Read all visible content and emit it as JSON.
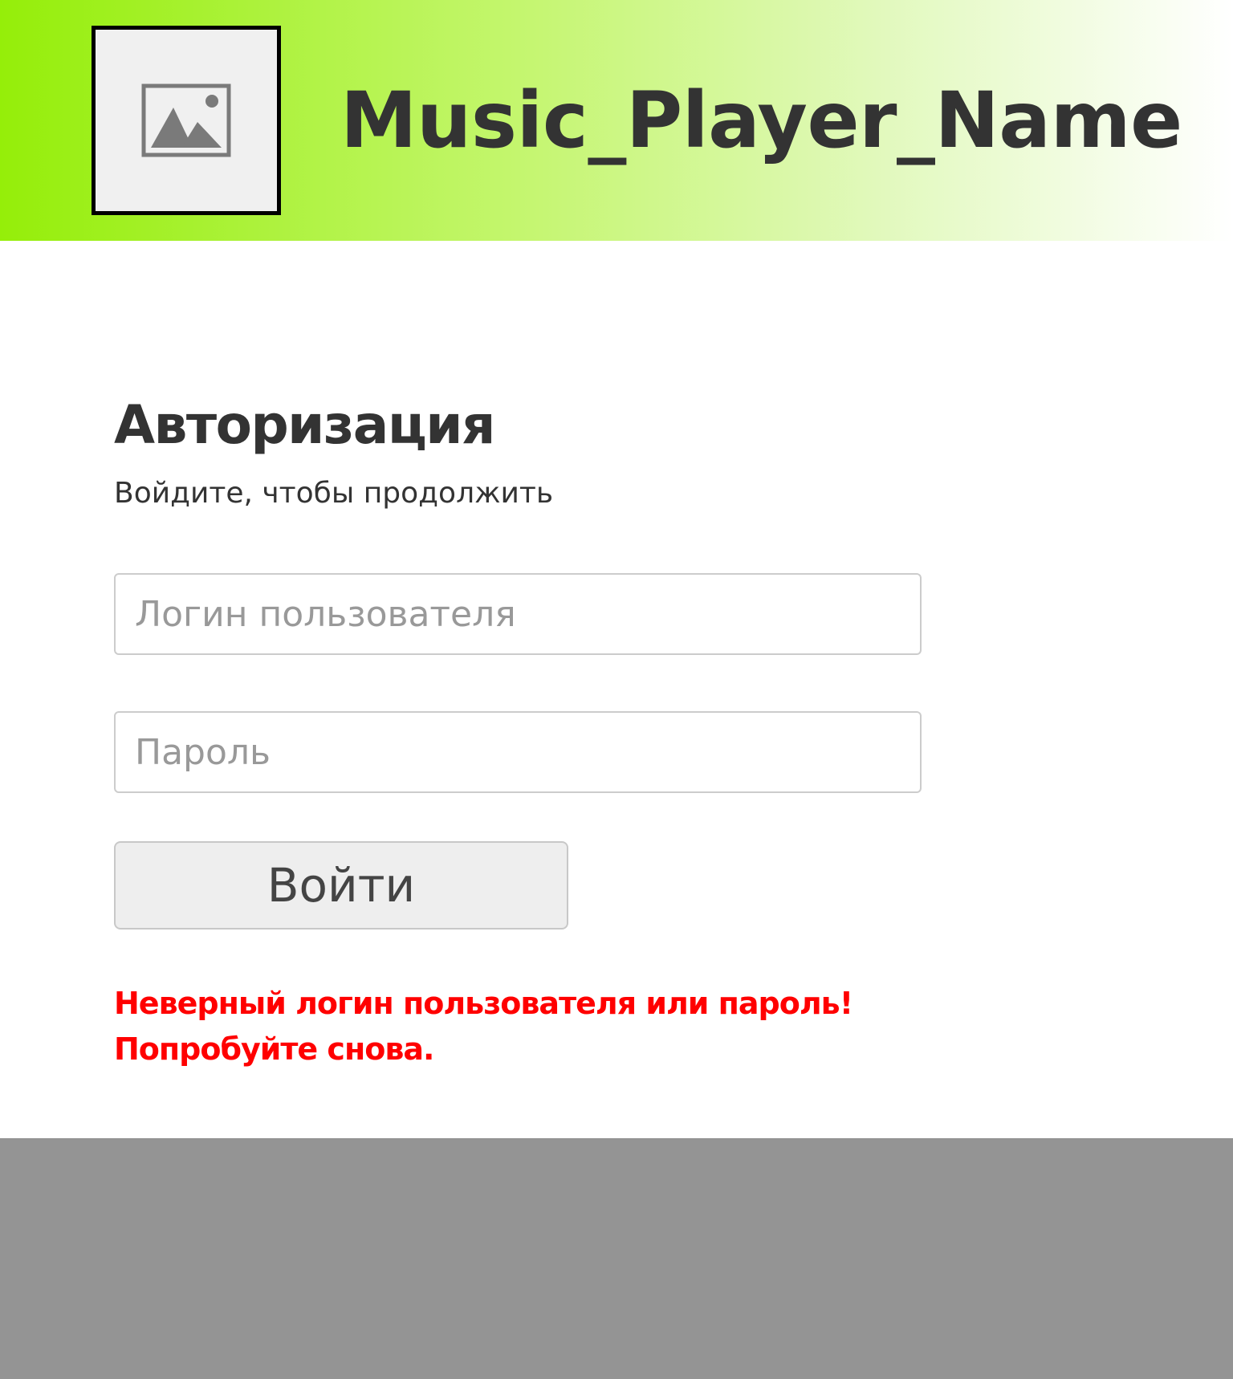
{
  "header": {
    "logo_icon": "image-placeholder-icon",
    "app_title": "Music_Player_Name",
    "gradient_start": "#95ee09",
    "gradient_end": "#ffffff"
  },
  "auth": {
    "title": "Авторизация",
    "subtitle": "Войдите, чтобы продолжить",
    "login_placeholder": "Логин пользователя",
    "login_value": "",
    "password_placeholder": "Пароль",
    "password_value": "",
    "submit_label": "Войти",
    "error_line1": "Неверный логин пользователя или пароль!",
    "error_line2": "Попробуйте снова.",
    "error_color": "#ff0000"
  },
  "footer": {
    "color": "#949494"
  }
}
